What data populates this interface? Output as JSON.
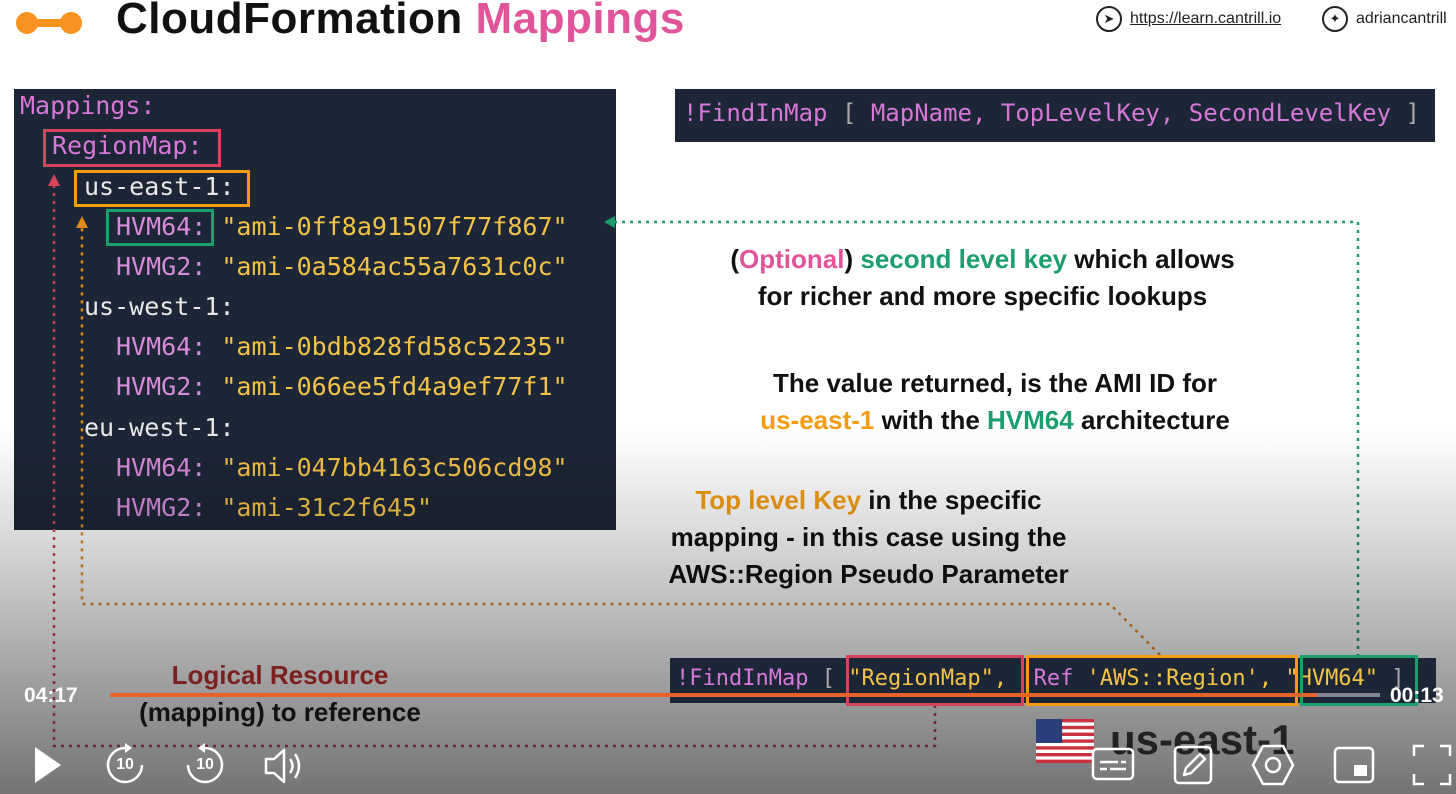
{
  "header": {
    "title_part1": "CloudFormation",
    "title_part2": "Mappings",
    "link_url": "https://learn.cantrill.io",
    "link_twitter": "adriancantrill"
  },
  "code": {
    "mappings": "Mappings:",
    "regionmap": "RegionMap:",
    "us_east_1": "us-east-1:",
    "us_west_1": "us-west-1:",
    "eu_west_1": "eu-west-1:",
    "hvm64_key": "HVM64:",
    "hvmg2_key": "HVMG2:",
    "ue_hvm64": "\"ami-0ff8a91507f77f867\"",
    "ue_hvmg2": "\"ami-0a584ac55a7631c0c\"",
    "uw_hvm64": "\"ami-0bdb828fd58c52235\"",
    "uw_hvmg2": "\"ami-066ee5fd4a9ef77f1\"",
    "ew_hvm64": "\"ami-047bb4163c506cd98\"",
    "ew_hvmg2": "\"ami-31c2f645\""
  },
  "syntax": {
    "fn": "!FindInMap",
    "open": "[",
    "a1": "MapName,",
    "a2": "TopLevelKey,",
    "a3": "SecondLevelKey",
    "close": "]"
  },
  "notes": {
    "optional_p1": "(",
    "optional_word": "Optional",
    "optional_p2": ")",
    "second_key": "second level key",
    "optional_rest1": "which allows",
    "optional_rest2": "for richer and more specific lookups",
    "value_line1": "The value returned, is the AMI ID for",
    "value_region": "us-east-1",
    "value_mid": "with the",
    "value_arch": "HVM64",
    "value_end": "architecture",
    "top_key": "Top level Key",
    "top_rest1": "in the specific",
    "top_rest2": "mapping - in this case using the",
    "top_rest3": "AWS::Region Pseudo Parameter",
    "logical1": "Logical Resource",
    "logical2": "(mapping) to reference"
  },
  "example": {
    "fn": "!FindInMap",
    "open": "[",
    "arg1": "\"RegionMap\",",
    "arg2_fn": "!Ref",
    "arg2": "'AWS::Region',",
    "arg3": "\"HVM64\"",
    "close": "]"
  },
  "region_caption": "us-east-1",
  "player": {
    "elapsed": "04:17",
    "remaining": "00:13",
    "progress": 0.95,
    "skip_back": "10",
    "skip_fwd": "10"
  },
  "colors": {
    "pink": "#e0549a",
    "green": "#1d9e6f",
    "orange": "#f39c12",
    "code_bg": "#1d2637",
    "progress": "#e8632a"
  }
}
